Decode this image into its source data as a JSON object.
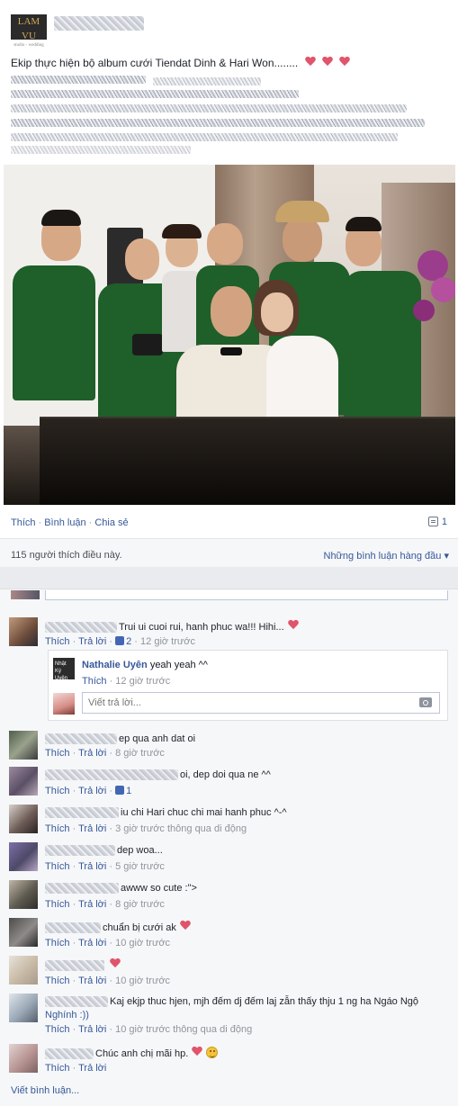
{
  "post": {
    "logo_text": "LAM VU",
    "logo_sub": "studio - wedding",
    "text": "Ekip thực hiện bộ album cưới Tiendat Dinh & Hari Won........",
    "photo_alt": "Group photo of the wedding album crew"
  },
  "actions": {
    "like": "Thích",
    "comment": "Bình luận",
    "share": "Chia sẻ",
    "share_count": "1"
  },
  "likes": {
    "count_text": "115 người thích điều này.",
    "top_comments": "Những bình luận hàng đầu ▾"
  },
  "comments": [
    {
      "text": "Trui ui cuoi rui, hanh phuc wa!!! Hihi...",
      "heart": true,
      "like": "Thích",
      "reply": "Trả lời",
      "likes": "2",
      "time": "12 giờ trước"
    },
    {
      "text": "ep qua anh dat oi",
      "like": "Thích",
      "reply": "Trả lời",
      "time": "8 giờ trước"
    },
    {
      "text": "oi, dep doi qua ne ^^",
      "like": "Thích",
      "reply": "Trả lời",
      "likes": "1",
      "time": ""
    },
    {
      "text": "iu chi Hari chuc chi mai hanh phuc ^-^",
      "like": "Thích",
      "reply": "Trả lời",
      "time": "3 giờ trước thông qua di động"
    },
    {
      "text": "dep woa...",
      "like": "Thích",
      "reply": "Trả lời",
      "time": "5 giờ trước"
    },
    {
      "text": "awww so cute :\">",
      "like": "Thích",
      "reply": "Trả lời",
      "time": "8 giờ trước"
    },
    {
      "text": "chuẩn bị cưới ak",
      "heart": true,
      "like": "Thích",
      "reply": "Trả lời",
      "time": "10 giờ trước"
    },
    {
      "text": "",
      "heart": true,
      "like": "Thích",
      "reply": "Trả lời",
      "time": "10 giờ trước"
    },
    {
      "text": "Kaj ekjp thuc hjen, mjh đếm dj đếm laj zẫn thấy thju 1 ng ha Ngáo Ngộ",
      "text2": "Nghính :))",
      "like": "Thích",
      "reply": "Trả lời",
      "time": "10 giờ trước thông qua di động"
    },
    {
      "text": "Chúc anh chị mãi hp.",
      "heart": true,
      "smile": true,
      "like": "Thích",
      "reply": "Trả lời",
      "time": ""
    }
  ],
  "reply": {
    "avatar_text": "Nhật Ký Uyên",
    "name": "Nathalie Uyên",
    "text": "yeah yeah ^^",
    "like": "Thích",
    "time": "12 giờ trước",
    "placeholder": "Viết trả lời..."
  },
  "write_comment": "Viết bình luận...",
  "colors": {
    "link": "#365899",
    "muted": "#90949c",
    "heart": "#e0556b",
    "shirt_green": "#1f5f2a"
  }
}
